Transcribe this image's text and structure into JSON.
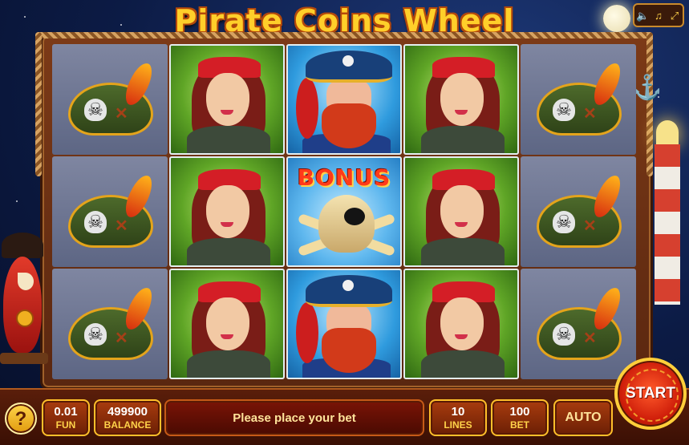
{
  "game": {
    "title": "Pirate Coins Wheel"
  },
  "system_buttons": {
    "sound": "🔈",
    "music": "♫",
    "fullscreen": "⤢"
  },
  "reels": [
    [
      "hat",
      "lady",
      "captain",
      "lady",
      "hat"
    ],
    [
      "hat",
      "lady",
      "bonus",
      "lady",
      "hat"
    ],
    [
      "hat",
      "lady",
      "captain",
      "lady",
      "hat"
    ]
  ],
  "symbols": {
    "bonus_label": "BONUS"
  },
  "controls": {
    "help": "?",
    "coin_value": "0.01",
    "coin_label": "FUN",
    "balance_value": "499900",
    "balance_label": "BALANCE",
    "message": "Please place your bet",
    "lines_value": "10",
    "lines_label": "LINES",
    "bet_value": "100",
    "bet_label": "BET",
    "auto": "AUTO",
    "start": "START"
  },
  "colors": {
    "title": "#ffcf2a",
    "button_border": "#ffbf2a",
    "start": "#cf1e0a"
  }
}
